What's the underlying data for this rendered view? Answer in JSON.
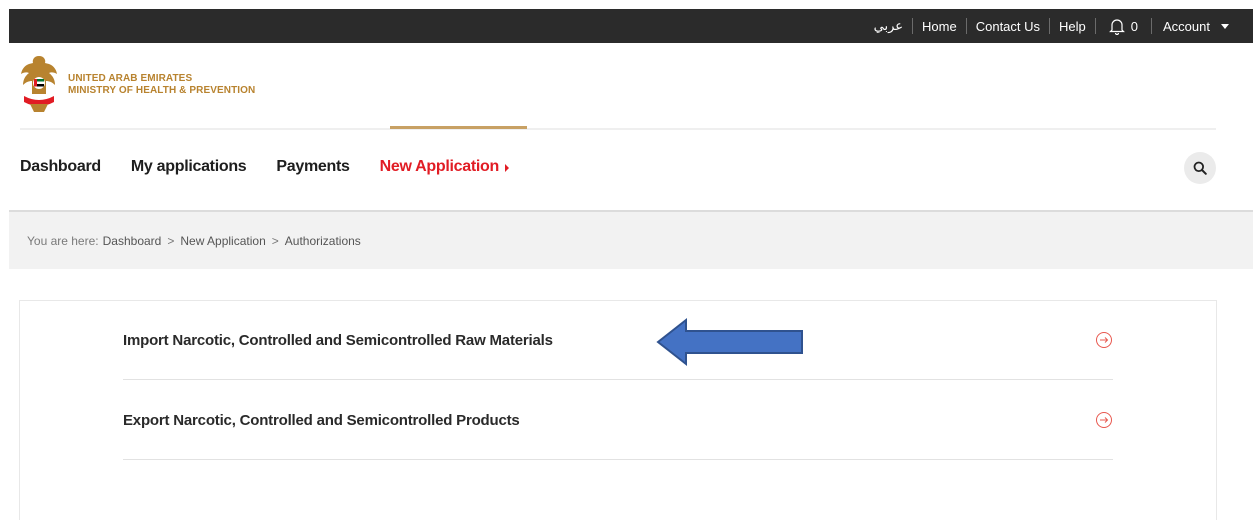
{
  "topbar": {
    "language": "عربي",
    "home": "Home",
    "contact": "Contact Us",
    "help": "Help",
    "notifications_count": "0",
    "account": "Account"
  },
  "brand": {
    "line1": "UNITED ARAB EMIRATES",
    "line2": "MINISTRY OF HEALTH & PREVENTION"
  },
  "nav": {
    "items": [
      {
        "label": "Dashboard"
      },
      {
        "label": "My applications"
      },
      {
        "label": "Payments"
      },
      {
        "label": "New Application"
      }
    ],
    "active_index": 3
  },
  "breadcrumb": {
    "lead": "You are here:",
    "items": [
      "Dashboard",
      "New Application",
      "Authorizations"
    ],
    "separator": ">"
  },
  "list": {
    "items": [
      {
        "label": "Import Narcotic, Controlled and Semicontrolled Raw Materials"
      },
      {
        "label": "Export Narcotic, Controlled and Semicontrolled Products"
      }
    ]
  },
  "colors": {
    "topbar_bg": "#2b2b2b",
    "brand_gold": "#b8832f",
    "active_red": "#e11c24",
    "annotation_arrow": "#4472c4"
  },
  "icons": {
    "bell": "bell-icon",
    "search": "search-icon",
    "row_arrow": "circle-arrow-right-icon",
    "annotation": "left-arrow-annotation"
  }
}
